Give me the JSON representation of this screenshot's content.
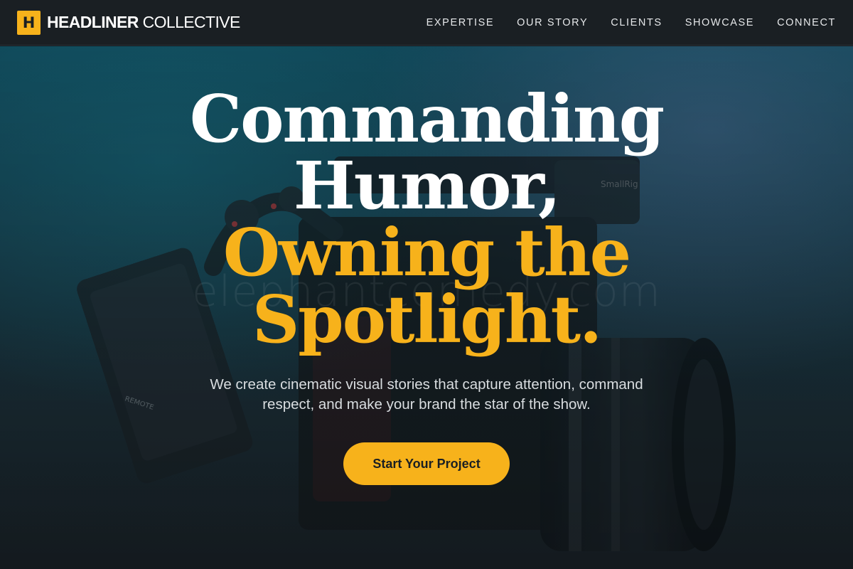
{
  "brand": {
    "logo_letter": "H",
    "name_bold": "HEADLINER",
    "name_light": " COLLECTIVE"
  },
  "nav": {
    "items": [
      {
        "label": "EXPERTISE"
      },
      {
        "label": "OUR STORY"
      },
      {
        "label": "CLIENTS"
      },
      {
        "label": "SHOWCASE"
      },
      {
        "label": "CONNECT"
      }
    ]
  },
  "hero": {
    "headline": {
      "line1": "Commanding",
      "line2": "Humor,",
      "line3": "Owning the",
      "line4": "Spotlight."
    },
    "watermark": "elephantcomedy.com",
    "subtext_line1": "We create cinematic visual stories that capture attention, command",
    "subtext_line2": "respect, and make your brand the star of the show.",
    "cta_label": "Start Your Project",
    "camera_text_remote": "REMOTE",
    "camera_text_brand": "SmallRig"
  },
  "colors": {
    "accent": "#f7b21b",
    "nav_bg": "#1a1f23",
    "hero_teal": "#114f62"
  }
}
